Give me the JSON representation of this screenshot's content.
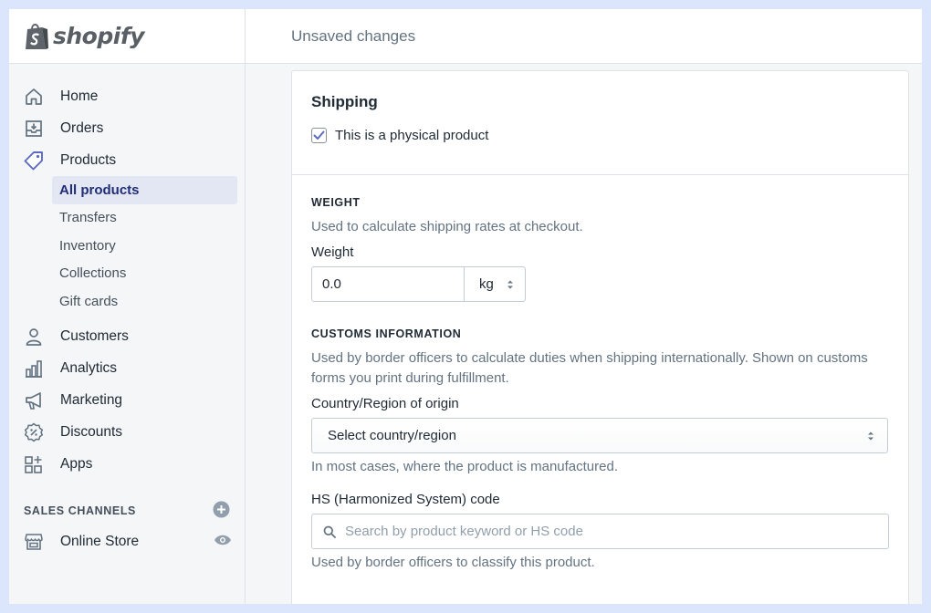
{
  "brand": {
    "name": "shopify",
    "logo_color": "#95bf47"
  },
  "topbar": {
    "title": "Unsaved changes"
  },
  "nav": {
    "items": [
      {
        "label": "Home",
        "icon": "home-icon"
      },
      {
        "label": "Orders",
        "icon": "orders-icon"
      },
      {
        "label": "Products",
        "icon": "tag-icon"
      }
    ],
    "products_sub": [
      {
        "label": "All products",
        "selected": true
      },
      {
        "label": "Transfers"
      },
      {
        "label": "Inventory"
      },
      {
        "label": "Collections"
      },
      {
        "label": "Gift cards"
      }
    ],
    "items2": [
      {
        "label": "Customers",
        "icon": "person-icon"
      },
      {
        "label": "Analytics",
        "icon": "bar-chart-icon"
      },
      {
        "label": "Marketing",
        "icon": "megaphone-icon"
      },
      {
        "label": "Discounts",
        "icon": "discount-icon"
      },
      {
        "label": "Apps",
        "icon": "apps-icon"
      }
    ],
    "sales_channels": {
      "heading": "SALES CHANNELS",
      "add_icon": "plus-circle-icon"
    },
    "online_store": {
      "label": "Online Store",
      "icon": "store-icon",
      "view_icon": "eye-icon"
    }
  },
  "shipping": {
    "title": "Shipping",
    "physical_product_label": "This is a physical product",
    "physical_product_checked": true,
    "weight": {
      "heading": "WEIGHT",
      "help": "Used to calculate shipping rates at checkout.",
      "label": "Weight",
      "value": "0.0",
      "unit": "kg"
    },
    "customs": {
      "heading": "CUSTOMS INFORMATION",
      "help": "Used by border officers to calculate duties when shipping internationally. Shown on customs forms you print during fulfillment.",
      "country_label": "Country/Region of origin",
      "country_value": "Select country/region",
      "country_help": "In most cases, where the product is manufactured.",
      "hs_label": "HS (Harmonized System) code",
      "hs_placeholder": "Search by product keyword or HS code",
      "hs_help": "Used by border officers to classify this product."
    }
  },
  "colors": {
    "accent": "#5c6ac4",
    "selected_bg": "#e3e7f4",
    "selected_text": "#202e78"
  }
}
